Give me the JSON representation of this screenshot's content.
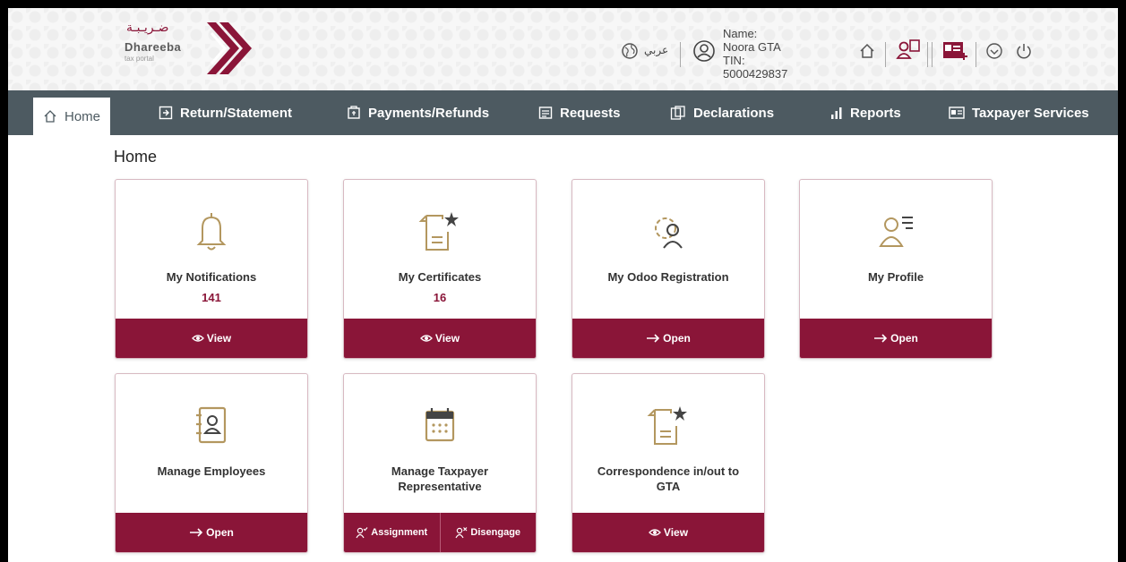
{
  "header": {
    "logo_arabic": "ضـريـبـة",
    "logo_name": "Dhareeba",
    "logo_tagline": "tax portal",
    "language_label": "عربي",
    "user_name": "Name: Noora GTA",
    "user_tin": "TIN: 5000429837",
    "icons": [
      "globe-icon",
      "user-circle-icon",
      "home-icon",
      "user-switch-icon",
      "id-card-icon",
      "chevron-circle-icon",
      "power-icon"
    ]
  },
  "nav": {
    "items": [
      {
        "label": "Home",
        "icon": "home-icon"
      },
      {
        "label": "Return/Statement",
        "icon": "return-icon"
      },
      {
        "label": "Payments/Refunds",
        "icon": "payment-icon"
      },
      {
        "label": "Requests",
        "icon": "requests-icon"
      },
      {
        "label": "Declarations",
        "icon": "declarations-icon"
      },
      {
        "label": "Reports",
        "icon": "reports-icon"
      },
      {
        "label": "Taxpayer Services",
        "icon": "services-icon"
      }
    ]
  },
  "page": {
    "title": "Home"
  },
  "cards": [
    {
      "title": "My Notifications",
      "count": "141",
      "action": "View",
      "icon": "bell-icon"
    },
    {
      "title": "My Certificates",
      "count": "16",
      "action": "View",
      "icon": "certificate-icon"
    },
    {
      "title": "My Odoo Registration",
      "action": "Open",
      "icon": "gear-user-icon"
    },
    {
      "title": "My Profile",
      "action": "Open",
      "icon": "profile-icon"
    },
    {
      "title": "Manage Employees",
      "action": "Open",
      "icon": "address-book-icon"
    },
    {
      "title_line1": "Manage Taxpayer",
      "title_line2": "Representative",
      "actions": [
        "Assignment",
        "Disengage"
      ],
      "icon": "calendar-icon"
    },
    {
      "title_line1": "Correspondence in/out to",
      "title_line2": "GTA",
      "action": "View",
      "icon": "document-star-icon"
    }
  ],
  "colors": {
    "accent": "#8a1538",
    "nav_bg": "#4d5a61",
    "icon_gold": "#b3975f"
  }
}
